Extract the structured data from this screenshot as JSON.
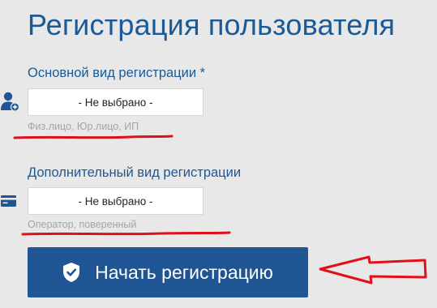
{
  "page": {
    "title": "Регистрация пользователя"
  },
  "primary_registration": {
    "label": "Основной вид регистрации *",
    "selected_value": "- Не выбрано -",
    "hint": "Физ.лицо, Юр.лицо, ИП",
    "icon": "add-user-icon"
  },
  "secondary_registration": {
    "label": "Дополнительный вид регистрации",
    "selected_value": "- Не выбрано -",
    "hint": "Оператор, поверенный",
    "icon": "credit-card-icon"
  },
  "actions": {
    "start_label": "Начать регистрацию",
    "start_icon": "shield-check-icon"
  },
  "colors": {
    "accent": "#1a5a96",
    "button": "#1f5592",
    "annotation": "#e0101a",
    "hint": "#a5a5a5"
  }
}
